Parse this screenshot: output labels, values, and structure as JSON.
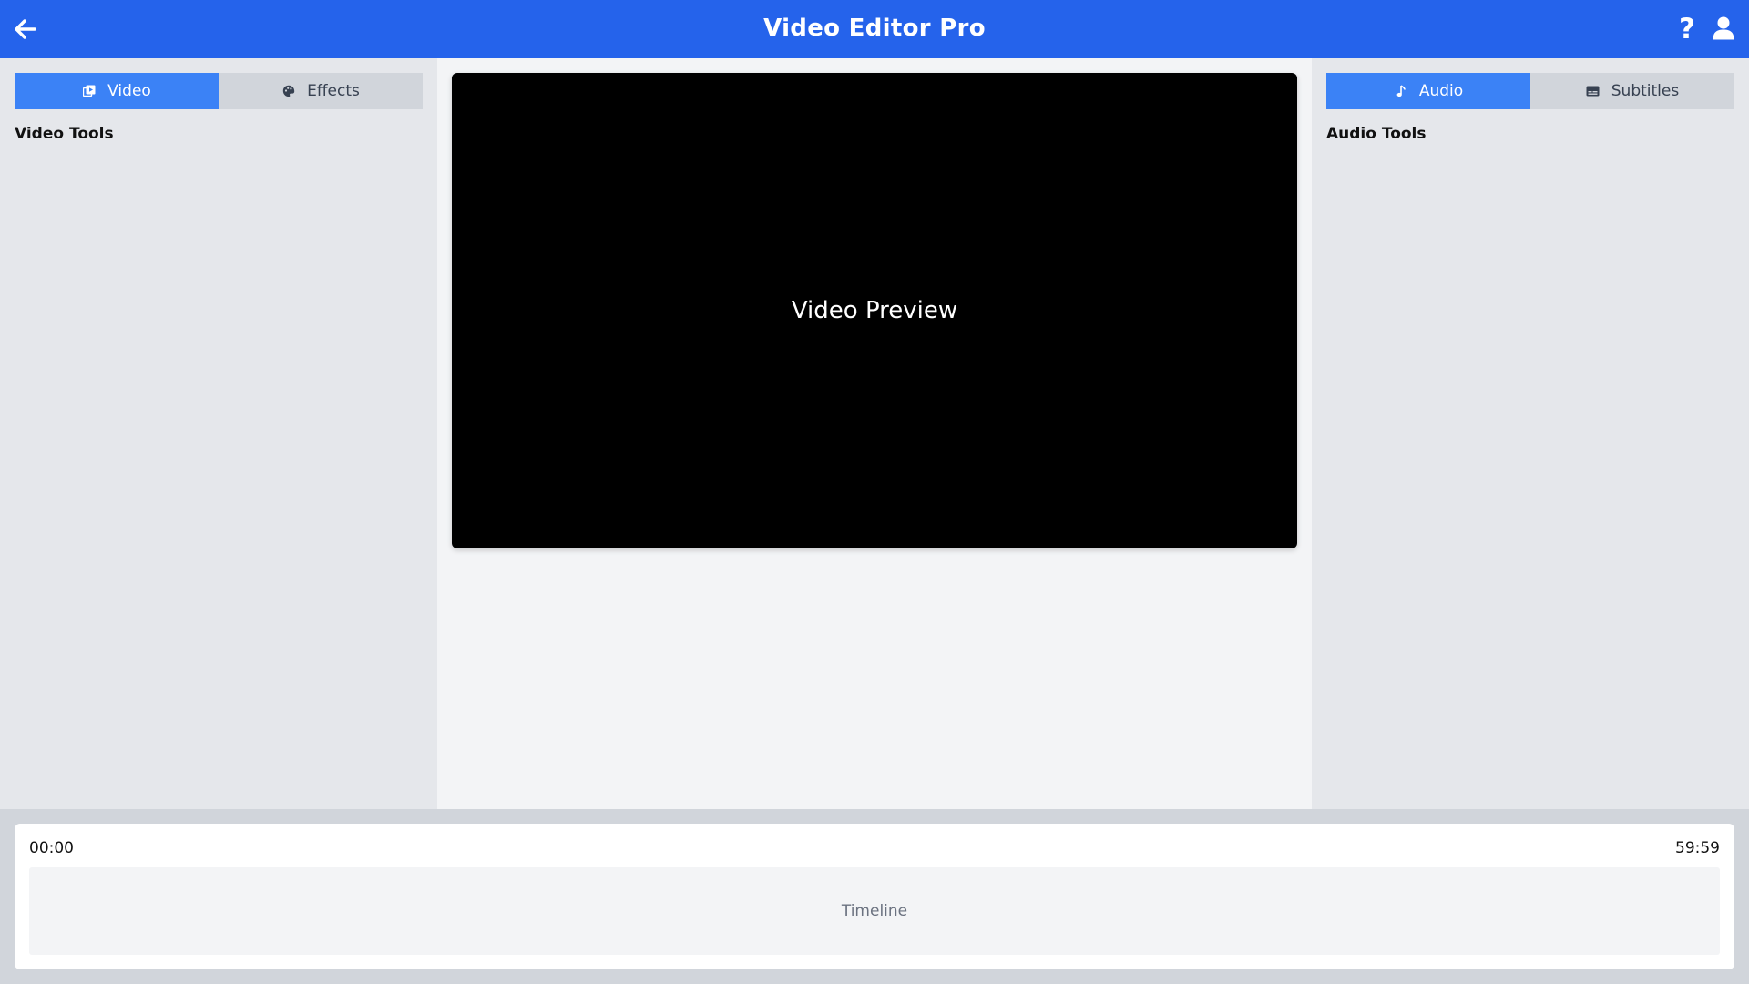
{
  "header": {
    "title": "Video Editor Pro",
    "help_label": "?",
    "icons": {
      "back": "arrow-left-icon",
      "help": "question-icon",
      "user": "user-icon"
    }
  },
  "left_panel": {
    "tabs": [
      {
        "label": "Video",
        "icon": "video-icon",
        "active": true
      },
      {
        "label": "Effects",
        "icon": "palette-icon",
        "active": false
      }
    ],
    "heading": "Video Tools"
  },
  "right_panel": {
    "tabs": [
      {
        "label": "Audio",
        "icon": "music-icon",
        "active": true
      },
      {
        "label": "Subtitles",
        "icon": "subtitles-icon",
        "active": false
      }
    ],
    "heading": "Audio Tools"
  },
  "preview": {
    "label": "Video Preview"
  },
  "timeline": {
    "start_time": "00:00",
    "end_time": "59:59",
    "label": "Timeline"
  },
  "colors": {
    "header_bg": "#2563eb",
    "tab_active": "#3b82f6",
    "tab_inactive": "#d1d5db",
    "panel_bg": "#e5e7eb",
    "center_bg": "#f3f4f6",
    "preview_bg": "#000000"
  }
}
